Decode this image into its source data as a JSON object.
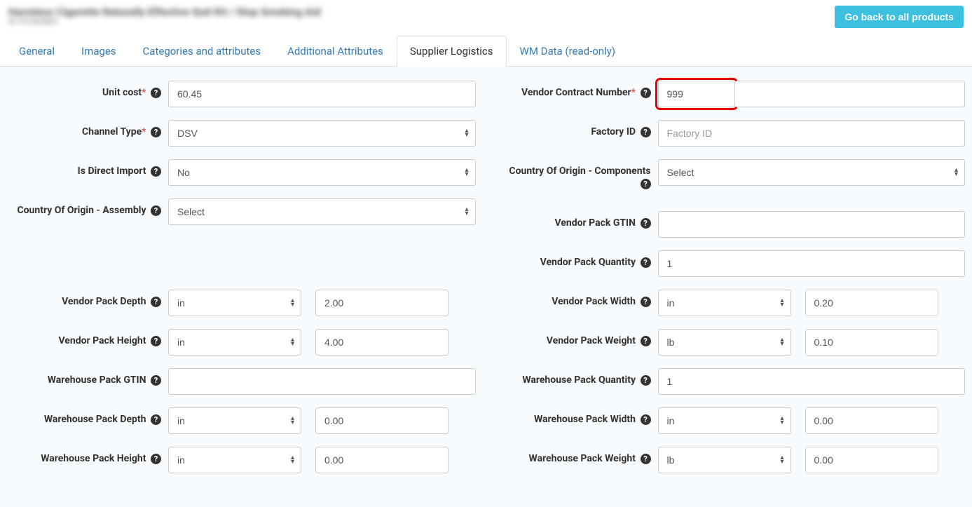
{
  "header": {
    "product_title": "Harmless Cigarette Naturally Effective Quit Kit / Stop Smoking Aid",
    "product_sub": "ID: 975 88 8829",
    "go_back_label": "Go back to all products"
  },
  "tabs": {
    "general": "General",
    "images": "Images",
    "categories": "Categories and attributes",
    "additional": "Additional Attributes",
    "supplier": "Supplier Logistics",
    "wm": "WM Data (read-only)"
  },
  "labels": {
    "unit_cost": "Unit cost",
    "channel_type": "Channel Type",
    "is_direct_import": "Is Direct Import",
    "coo_assembly": "Country Of Origin - Assembly",
    "vendor_pack_depth": "Vendor Pack Depth",
    "vendor_pack_height": "Vendor Pack Height",
    "warehouse_pack_gtin": "Warehouse Pack GTIN",
    "warehouse_pack_depth": "Warehouse Pack Depth",
    "warehouse_pack_height": "Warehouse Pack Height",
    "vendor_contract_number": "Vendor Contract Number",
    "factory_id": "Factory ID",
    "coo_components": "Country Of Origin - Components",
    "vendor_pack_gtin": "Vendor Pack GTIN",
    "vendor_pack_quantity": "Vendor Pack Quantity",
    "vendor_pack_width": "Vendor Pack Width",
    "vendor_pack_weight": "Vendor Pack Weight",
    "warehouse_pack_quantity": "Warehouse Pack Quantity",
    "warehouse_pack_width": "Warehouse Pack Width",
    "warehouse_pack_weight": "Warehouse Pack Weight"
  },
  "values": {
    "unit_cost": "60.45",
    "channel_type": "DSV",
    "is_direct_import": "No",
    "coo_assembly": "Select",
    "vendor_pack_depth_unit": "in",
    "vendor_pack_depth_val": "2.00",
    "vendor_pack_height_unit": "in",
    "vendor_pack_height_val": "4.00",
    "warehouse_pack_gtin": "",
    "warehouse_pack_depth_unit": "in",
    "warehouse_pack_depth_val": "0.00",
    "warehouse_pack_height_unit": "in",
    "warehouse_pack_height_val": "0.00",
    "vendor_contract_number": "999",
    "factory_id": "",
    "factory_id_placeholder": "Factory ID",
    "coo_components": "Select",
    "vendor_pack_gtin": "",
    "vendor_pack_quantity": "1",
    "vendor_pack_width_unit": "in",
    "vendor_pack_width_val": "0.20",
    "vendor_pack_weight_unit": "lb",
    "vendor_pack_weight_val": "0.10",
    "warehouse_pack_quantity": "1",
    "warehouse_pack_width_unit": "in",
    "warehouse_pack_width_val": "0.00",
    "warehouse_pack_weight_unit": "lb",
    "warehouse_pack_weight_val": "0.00"
  }
}
